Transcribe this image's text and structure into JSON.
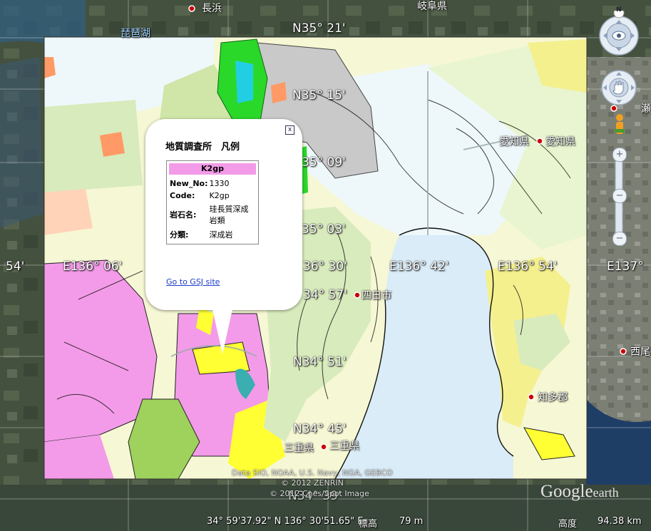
{
  "places": {
    "nagahama": "長浜",
    "gifu": "岐阜県",
    "biwako": "琵琶湖",
    "aichi_pref": "愛知県",
    "aichi_pref2": "愛知県",
    "yokkaichi": "四日市",
    "chita": "知多郡",
    "mie": "三重県",
    "mie2": "三重県",
    "nishio": "西尾",
    "edge_char": "瀬"
  },
  "grid": {
    "n35_21": "N35° 21'",
    "n35_15": "N35° 15'",
    "n35_09": "35° 09'",
    "n35_03": "35° 03'",
    "n34_57": "34° 57'",
    "n34_51": "N34° 51'",
    "n34_45": "N34° 45'",
    "lat_bottom": "N34° 39'",
    "w_54": "54'",
    "e136_06": "E136° 06'",
    "e136_30": "36° 30'",
    "e136_42": "E136° 42'",
    "e136_54": "E136° 54'",
    "e137": "E137°"
  },
  "popup": {
    "title": "地質調査所　凡例",
    "close_glyph": "x",
    "legend_header": "K2gp",
    "rows": [
      {
        "key": "New_No:",
        "value": "1330"
      },
      {
        "key": "Code:",
        "value": "K2gp"
      },
      {
        "key": "岩石名:",
        "value": "珪長質深成岩類"
      },
      {
        "key": "分類:",
        "value": "深成岩"
      }
    ],
    "link": "Go to GSJ site"
  },
  "credits": {
    "data": "Data SIO, NOAA, U.S. Navy, NGA, GEBCO",
    "zenrin": "© 2012 ZENRIN",
    "cnes": "© 2012 Cnes/Spot Image"
  },
  "brand": {
    "google": "Google",
    "earth": "earth"
  },
  "status": {
    "coords": "34° 59'37.92\" N 136° 30'51.65\" E",
    "elev_label": "標高",
    "elev_value": "79 m",
    "alt_label": "高度",
    "alt_value": "94.38 km"
  },
  "nav": {
    "north": "N",
    "zoom_in": "+",
    "zoom_out": "−"
  },
  "colors": {
    "granite_pink": "#f39be8",
    "sea": "#d9ecf7",
    "link": "#1a3ccc"
  }
}
